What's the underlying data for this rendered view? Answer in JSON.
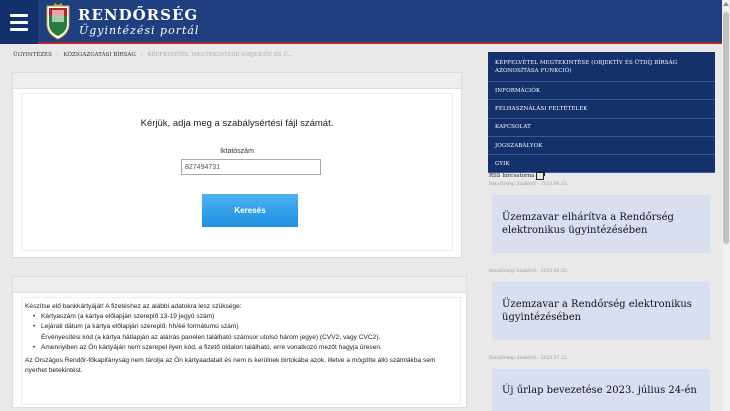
{
  "header": {
    "brand_title": "RENDŐRSÉG",
    "brand_subtitle": "Ügyintézési portál"
  },
  "breadcrumb": {
    "items": [
      "ÜGYINTÉZÉS",
      "KÖZIGAZGATÁSI BÍRSÁG"
    ],
    "current": "KÉPFELVÉTEL MEGTEKINTÉSE (OBJEKTÍV ÉS Ü..."
  },
  "lookup_form": {
    "prompt": "Kérjük, adja meg a szabálysértési fájl számát.",
    "field_label": "Iktatószám",
    "field_value": "827494731",
    "search_button": "Keresés"
  },
  "card_info": {
    "intro": "Készítse elő bankkártyáját! A fizetéshez az alábbi adatokra lesz szüksége:",
    "items": [
      "Kártyaszám (a kártya előlapján szereplő 13-19 jegyű szám)",
      "Lejárati dátum (a kártya előlapján szereplő, hh/éé formátumú szám)",
      "Érvényesítési kód (a kártya hátlapján az aláírás panelen található számsor utolsó három jegye) (CVV2, vagy CVC2).",
      "Amennyiben az Ön kártyáján nem szerepel ilyen kód, a fizető oldalon található, erre vonatkozó mezőt hagyja üresen."
    ],
    "note": "Az Országos Rendőr-főkapitányság nem tárolja az Ön kártyaadatait és nem is kerülnek birtokába azok, illetve a mögötte álló számlákba sem nyerhet betekintést."
  },
  "sidebar": {
    "items": [
      "KÉPFELVÉTEL MEGTEKINTÉSE (OBJEKTÍV ÉS ÜTDÍJ BÍRSÁG AZONOSÍTÁSA FUNKCIÓ)",
      "INFORMÁCIÓK",
      "FELHASZNÁLÁSI FELTÉTELEK",
      "KAPCSOLAT",
      "JOGSZABÁLYOK",
      "GYIK"
    ],
    "rss_label": "RSS hírcsatorna"
  },
  "news": [
    {
      "meta": "Rendőrségi Szakértő · 2023.08.03.",
      "title": "Üzemzavar elhárítva a Rendőrség elektronikus ügyintézésében"
    },
    {
      "meta": "Rendőrségi Szakértő · 2023.08.03.",
      "title": "Üzemzavar a Rendőrség elektronikus ügyintézésében"
    },
    {
      "meta": "Rendőrségi Szakértő · 2023.07.23.",
      "title": "Új űrlap bevezetése 2023. július 24-én"
    }
  ],
  "colors": {
    "header_bg": "#1f3f7e",
    "accent_red": "#b3262f",
    "nav_bg": "#14316b",
    "button_blue": "#33a4ee",
    "news_card_bg": "#d9dff1"
  }
}
